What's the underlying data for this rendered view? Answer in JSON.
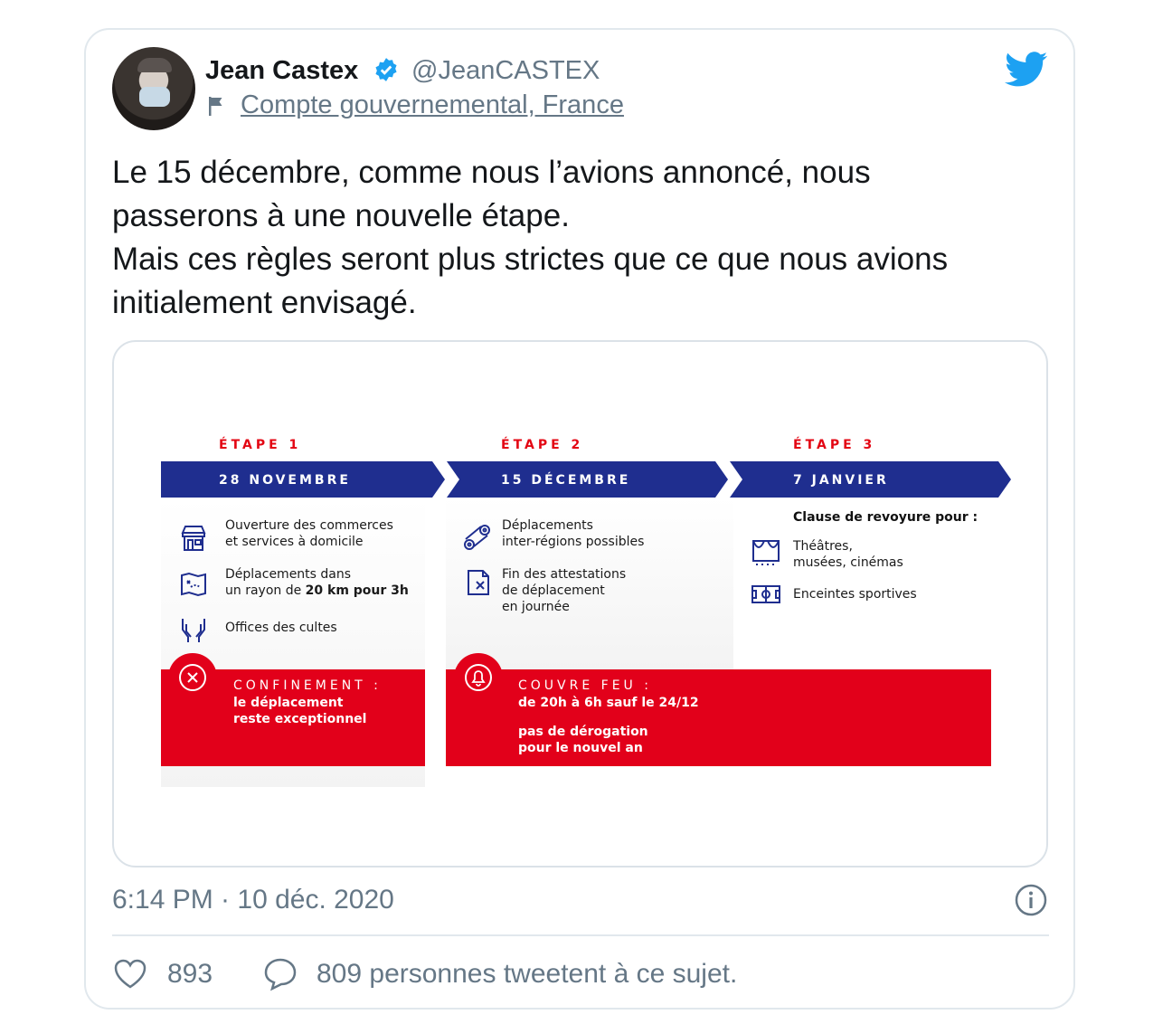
{
  "tweet": {
    "author_name": "Jean Castex",
    "author_handle": "@JeanCASTEX",
    "account_label": "Compte gouvernemental, France",
    "text_lines": [
      "Le 15 décembre, comme nous l’avions annoncé, nous",
      "passerons à une nouvelle étape.",
      "Mais ces règles seront plus strictes que ce que nous avions",
      "initialement envisagé."
    ],
    "timestamp": "6:14 PM · 10 déc. 2020",
    "likes": "893",
    "talking": "809 personnes tweetent à ce sujet."
  },
  "infographic": {
    "steps": [
      {
        "label": "ÉTAPE 1",
        "date": "28 NOVEMBRE",
        "items": [
          {
            "icon": "shop-icon",
            "lines": [
              "Ouverture des commerces",
              "et services à domicile"
            ]
          },
          {
            "icon": "map-icon",
            "lines": [
              "Déplacements dans",
              "un rayon de 20 km pour 3h"
            ]
          },
          {
            "icon": "hands-icon",
            "lines": [
              "Offices des cultes"
            ]
          }
        ],
        "banner_title": "CONFINEMENT :",
        "banner_lines": [
          "le déplacement",
          "reste exceptionnel"
        ],
        "banner_icon": "close-circle-icon"
      },
      {
        "label": "ÉTAPE 2",
        "date": "15 DÉCEMBRE",
        "items": [
          {
            "icon": "route-icon",
            "lines": [
              "Déplacements",
              "inter-régions possibles"
            ]
          },
          {
            "icon": "document-cross-icon",
            "lines": [
              "Fin des attestations",
              "de déplacement",
              "en journée"
            ]
          }
        ],
        "banner_title": "COUVRE FEU :",
        "banner_lines": [
          "de 20h à 6h sauf le 24/12",
          "pas de dérogation",
          "pour le nouvel an"
        ],
        "banner_icon": "bell-icon"
      },
      {
        "label": "ÉTAPE 3",
        "date": "7 JANVIER",
        "clause": "Clause de revoyure pour :",
        "items": [
          {
            "icon": "theater-icon",
            "lines": [
              "Théâtres,",
              "musées, cinémas"
            ]
          },
          {
            "icon": "stadium-icon",
            "lines": [
              "Enceintes sportives"
            ]
          }
        ]
      }
    ]
  },
  "colors": {
    "navy": "#1f2e8f",
    "red": "#e2001a",
    "twitter_blue": "#1da1f2",
    "muted": "#657786"
  }
}
